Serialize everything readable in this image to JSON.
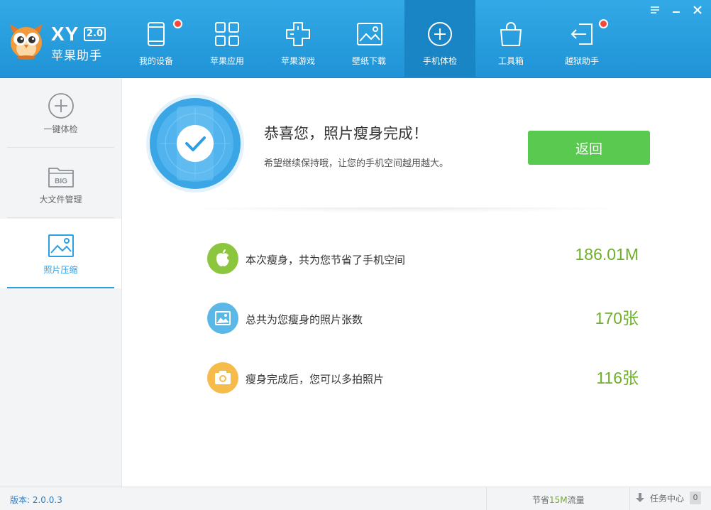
{
  "app": {
    "logo_text": "XY",
    "logo_version": "2.0",
    "logo_name": "苹果助手"
  },
  "nav": {
    "items": [
      {
        "label": "我的设备",
        "icon": "device-icon",
        "has_dot": true
      },
      {
        "label": "苹果应用",
        "icon": "apps-grid-icon",
        "has_dot": false
      },
      {
        "label": "苹果游戏",
        "icon": "gamepad-icon",
        "has_dot": false
      },
      {
        "label": "壁纸下载",
        "icon": "wallpaper-icon",
        "has_dot": false
      },
      {
        "label": "手机体检",
        "icon": "checkup-icon",
        "has_dot": false,
        "active": true
      },
      {
        "label": "工具箱",
        "icon": "toolbox-icon",
        "has_dot": false
      },
      {
        "label": "越狱助手",
        "icon": "jailbreak-icon",
        "has_dot": true
      }
    ],
    "dot_color": "#f24a3c"
  },
  "sidebar": {
    "items": [
      {
        "label": "一键体检",
        "icon": "plus-circle-icon"
      },
      {
        "label": "大文件管理",
        "icon": "big-folder-icon",
        "icon_text": "BIG"
      },
      {
        "label": "照片压缩",
        "icon": "photo-icon",
        "active": true
      }
    ]
  },
  "result": {
    "title": "恭喜您，照片瘦身完成！",
    "subtitle": "希望继续保持哦，让您的手机空间越用越大。",
    "back_label": "返回"
  },
  "stats": [
    {
      "label": "本次瘦身，共为您节省了手机空间",
      "value": "186.01M",
      "icon": "apple-icon",
      "color": "#8cc63f"
    },
    {
      "label": "总共为您瘦身的照片张数",
      "value": "170张",
      "icon": "image-icon",
      "color": "#5bb8e6"
    },
    {
      "label": "瘦身完成后，您可以多拍照片",
      "value": "116张",
      "icon": "camera-icon",
      "color": "#f5bb4b"
    }
  ],
  "statusbar": {
    "version": "版本: 2.0.0.3",
    "saved_prefix": "节省",
    "saved_amount": "15M",
    "saved_suffix": "流量",
    "tasks_label": "任务中心",
    "tasks_count": "0"
  },
  "colors": {
    "accent": "#2c9ee3",
    "topbar": "#2aa0e0",
    "success": "#5ac94f",
    "value_green": "#6daf2a"
  }
}
